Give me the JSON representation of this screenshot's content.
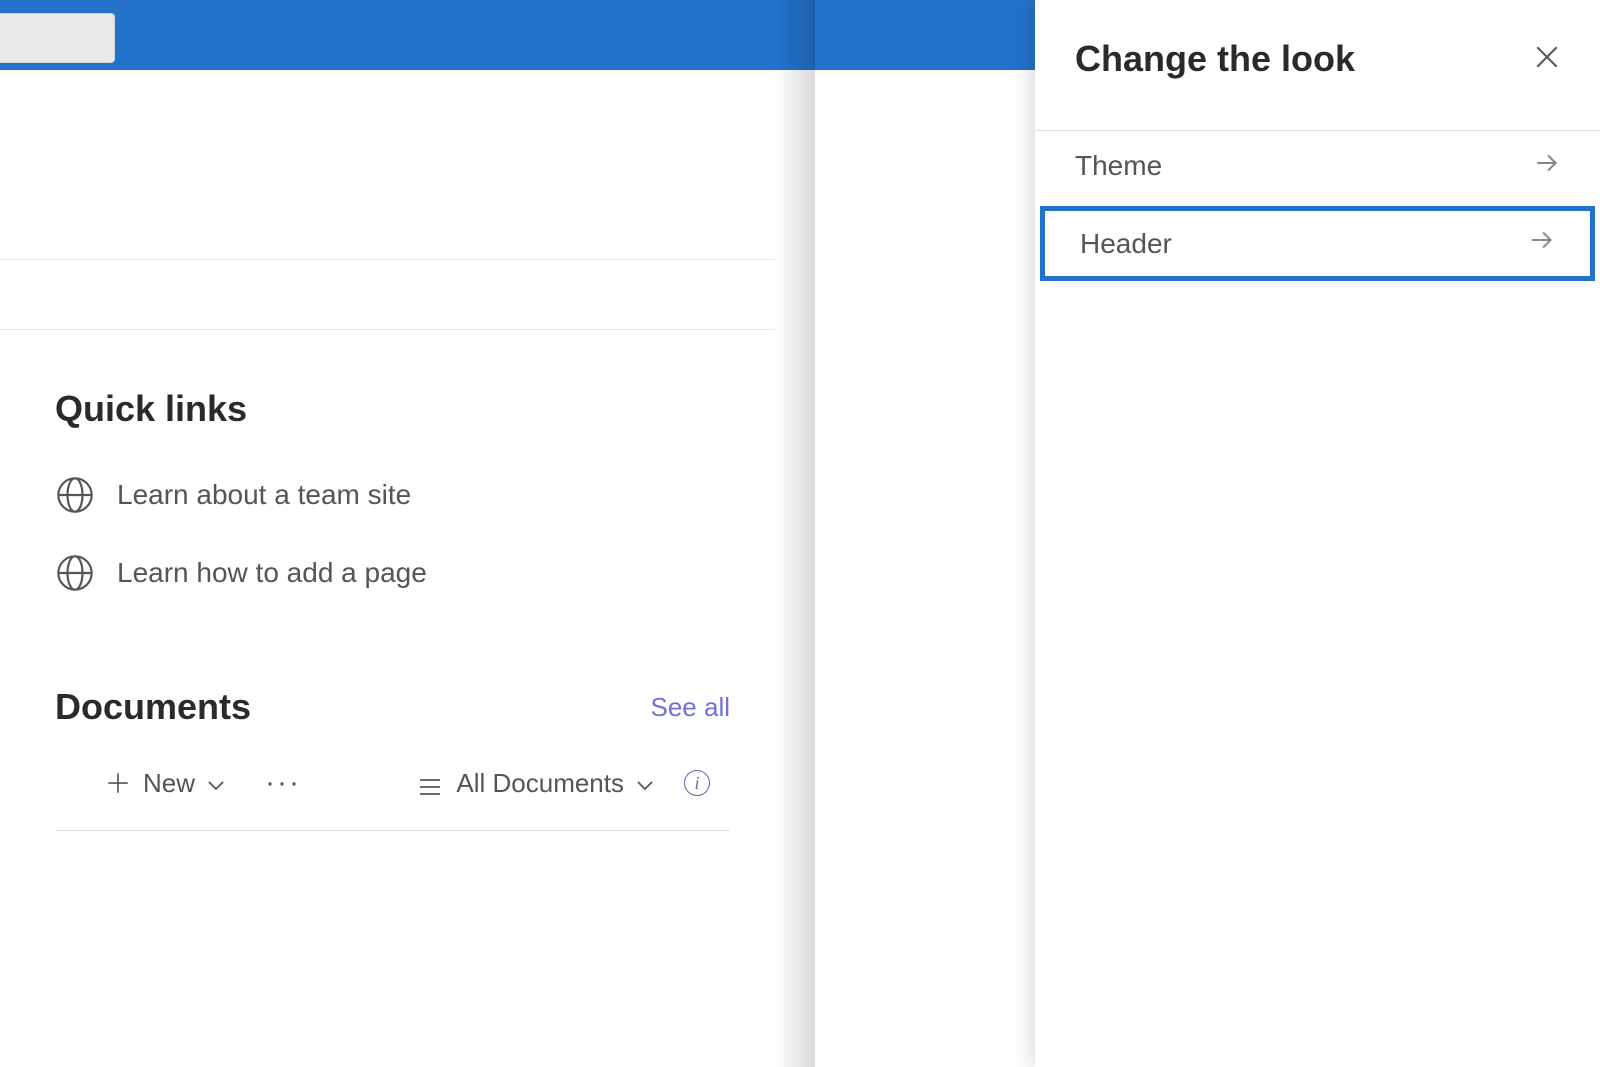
{
  "panel": {
    "title": "Change the look",
    "items": [
      {
        "label": "Theme"
      },
      {
        "label": "Header"
      }
    ]
  },
  "quick_links": {
    "title": "Quick links",
    "items": [
      {
        "label": "Learn about a team site"
      },
      {
        "label": "Learn how to add a page"
      }
    ]
  },
  "documents": {
    "title": "Documents",
    "see_all": "See all",
    "new_label": "New",
    "view_label": "All Documents"
  }
}
